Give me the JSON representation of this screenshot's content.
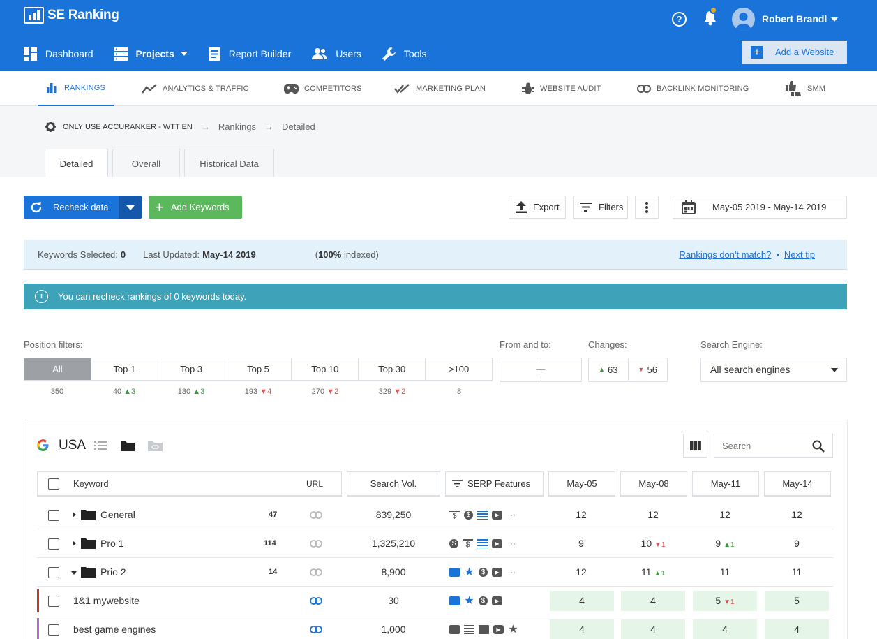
{
  "app": {
    "name": "SE Ranking",
    "user": "Robert Brandl"
  },
  "mainnav": [
    {
      "label": "Dashboard",
      "icon": "dashboard-icon"
    },
    {
      "label": "Projects",
      "icon": "projects-icon"
    },
    {
      "label": "Report Builder",
      "icon": "report-icon"
    },
    {
      "label": "Users",
      "icon": "users-icon"
    },
    {
      "label": "Tools",
      "icon": "wrench-icon"
    }
  ],
  "add_site": "Add a Website",
  "subnav": [
    {
      "label": "RANKINGS",
      "icon": "bar-chart-icon"
    },
    {
      "label": "ANALYTICS & TRAFFIC",
      "icon": "trend-icon"
    },
    {
      "label": "COMPETITORS",
      "icon": "gamepad-icon"
    },
    {
      "label": "MARKETING PLAN",
      "icon": "checkmarks-icon"
    },
    {
      "label": "WEBSITE AUDIT",
      "icon": "bug-icon"
    },
    {
      "label": "BACKLINK MONITORING",
      "icon": "link-icon"
    },
    {
      "label": "SMM",
      "icon": "thumbs-icon"
    }
  ],
  "breadcrumb": {
    "project": "ONLY USE ACCURANKER - WTT EN",
    "section": "Rankings",
    "page": "Detailed"
  },
  "tabs": [
    "Detailed",
    "Overall",
    "Historical Data"
  ],
  "toolbar": {
    "recheck": "Recheck data",
    "add_keywords": "Add Keywords",
    "export": "Export",
    "filters": "Filters",
    "date_range": "May-05 2019 - May-14 2019"
  },
  "info": {
    "selected_label": "Keywords Selected:",
    "selected": "0",
    "updated_label": "Last Updated:",
    "updated": "May-14 2019",
    "indexed_pct": "100%",
    "indexed_label": "indexed",
    "mismatch_link": "Rankings don't match?",
    "sep": "•",
    "next_tip": "Next tip"
  },
  "notice": "You can recheck rankings of 0 keywords today.",
  "filters": {
    "position_label": "Position filters:",
    "from_to_label": "From and to:",
    "from_to_value": "—",
    "changes_label": "Changes:",
    "changes_up": "63",
    "changes_down": "56",
    "engine_label": "Search Engine:",
    "engine_value": "All search engines",
    "positions": [
      {
        "label": "All",
        "count": "350",
        "delta": "",
        "dir": ""
      },
      {
        "label": "Top 1",
        "count": "40",
        "delta": "3",
        "dir": "up"
      },
      {
        "label": "Top 3",
        "count": "130",
        "delta": "3",
        "dir": "up"
      },
      {
        "label": "Top 5",
        "count": "193",
        "delta": "4",
        "dir": "down"
      },
      {
        "label": "Top 10",
        "count": "270",
        "delta": "2",
        "dir": "down"
      },
      {
        "label": "Top 30",
        "count": "329",
        "delta": "2",
        "dir": "down"
      },
      {
        "label": ">100",
        "count": "8",
        "delta": "",
        "dir": ""
      }
    ]
  },
  "table": {
    "region": "USA",
    "search_placeholder": "Search",
    "columns": {
      "keyword": "Keyword",
      "url": "URL",
      "volume": "Search Vol.",
      "serp": "SERP Features",
      "dates": [
        "May-05",
        "May-08",
        "May-11",
        "May-14"
      ]
    },
    "rows": [
      {
        "name": "General",
        "count": "47",
        "volume": "839,250",
        "positions": [
          "12",
          "12",
          "12",
          "12"
        ],
        "deltas": [
          "",
          "",
          "",
          ""
        ],
        "dirs": [
          "",
          "",
          "",
          ""
        ]
      },
      {
        "name": "Pro 1",
        "count": "114",
        "volume": "1,325,210",
        "positions": [
          "9",
          "10",
          "9",
          "9"
        ],
        "deltas": [
          "",
          "1",
          "1",
          ""
        ],
        "dirs": [
          "",
          "down",
          "up",
          ""
        ]
      },
      {
        "name": "Prio 2",
        "count": "14",
        "volume": "8,900",
        "positions": [
          "12",
          "11",
          "11",
          "11"
        ],
        "deltas": [
          "",
          "1",
          "",
          ""
        ],
        "dirs": [
          "",
          "up",
          "",
          ""
        ]
      },
      {
        "name": "1&1 mywebsite",
        "volume": "30",
        "positions": [
          "4",
          "4",
          "5",
          "5"
        ],
        "deltas": [
          "",
          "",
          "1",
          ""
        ],
        "dirs": [
          "",
          "",
          "down",
          ""
        ]
      },
      {
        "name": "best game engines",
        "volume": "1,000",
        "positions": [
          "4",
          "4",
          "4",
          "4"
        ],
        "deltas": [
          "",
          "",
          "",
          ""
        ],
        "dirs": [
          "",
          "",
          "",
          ""
        ]
      }
    ]
  },
  "colors": {
    "primary": "#1a73d9",
    "green": "#5cb85c",
    "teal": "#3ea2b8",
    "row_marker_1": "#c0392b",
    "row_marker_2": "#b36ad9"
  }
}
